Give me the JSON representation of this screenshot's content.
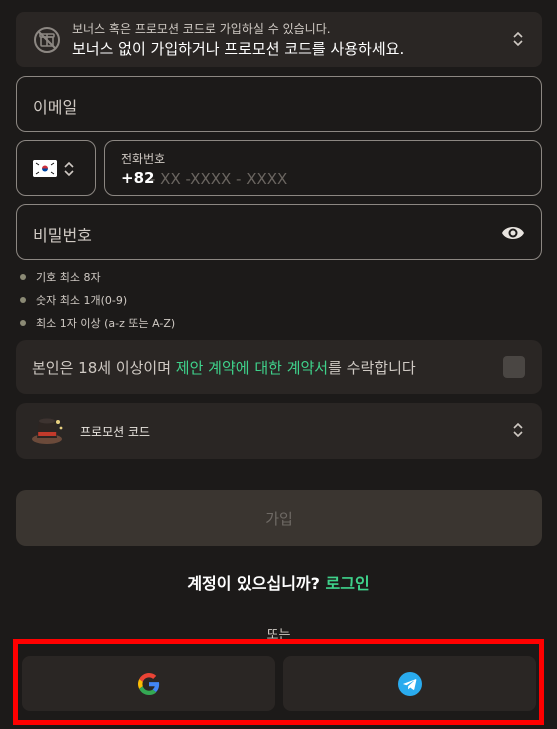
{
  "bonus": {
    "hint": "보너스 혹은 프로모션 코드로 가입하실 수 있습니다.",
    "title": "보너스 없이 가입하거나 프로모션 코드를 사용하세요."
  },
  "email": {
    "placeholder": "이메일"
  },
  "phone": {
    "label": "전화번호",
    "country_code": "+82",
    "placeholder": "- XX -XXXX - XXXX",
    "country_flag": "south-korea-flag"
  },
  "password": {
    "placeholder": "비밀번호",
    "rules": [
      "기호 최소 8자",
      "숫자 최소 1개(0-9)",
      "최소 1자 이상 (a-z 또는 A-Z)"
    ]
  },
  "terms": {
    "prefix": "본인은 18세 이상이며 ",
    "link": "제안 계약에 대한 계약서",
    "suffix": "를 수락합니다"
  },
  "promo": {
    "label": "프로모션 코드"
  },
  "signup_button": "가입",
  "login": {
    "question": "계정이 있으십니까? ",
    "link": "로그인"
  },
  "or_label": "또는",
  "social": {
    "google_icon": "google-icon",
    "telegram_icon": "telegram-icon"
  },
  "colors": {
    "accent": "#3fd28b",
    "highlight": "#ff0000",
    "background": "#1c1a19",
    "panel": "#2a2624"
  }
}
